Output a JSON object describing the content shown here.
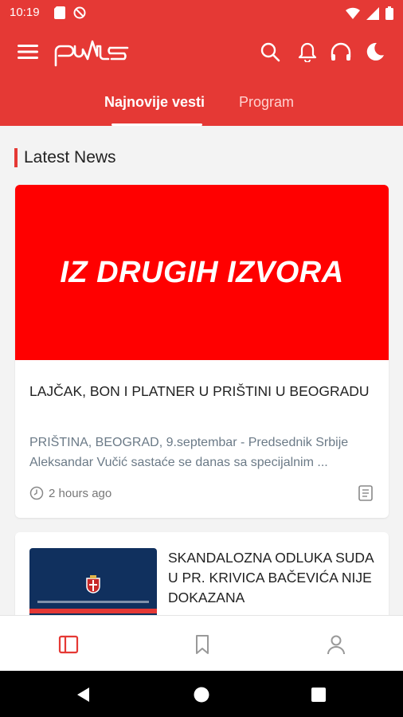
{
  "status_bar": {
    "time": "10:19"
  },
  "app_bar": {
    "logo_text": "puls",
    "tabs": [
      {
        "label": "Najnovije vesti",
        "active": true
      },
      {
        "label": "Program",
        "active": false
      }
    ]
  },
  "section": {
    "title": "Latest News"
  },
  "articles": [
    {
      "image_text": "IZ DRUGIH IZVORA",
      "title": "LAJČAK, BON I PLATNER U PRIŠTINI U BEOGRADU",
      "excerpt": "PRIŠTINA, BEOGRAD, 9.septembar - Predsednik Srbije Aleksandar Vučić sastaće se danas sa specijalnim ...",
      "time": "2 hours ago"
    },
    {
      "title": "SKANDALOZNA ODLUKA SUDA U PR. KRIVICA BAČEVIĆA NIJE DOKAZANA"
    }
  ],
  "colors": {
    "brand": "#e53935",
    "hero": "#ff0000",
    "excerpt": "#6b7a87"
  },
  "icons": {
    "menu": "hamburger-icon",
    "search": "search-icon",
    "notifications": "bell-icon",
    "audio": "headphones-icon",
    "theme": "moon-icon",
    "nav_news": "news-icon",
    "nav_saved": "bookmark-icon",
    "nav_profile": "profile-icon"
  }
}
